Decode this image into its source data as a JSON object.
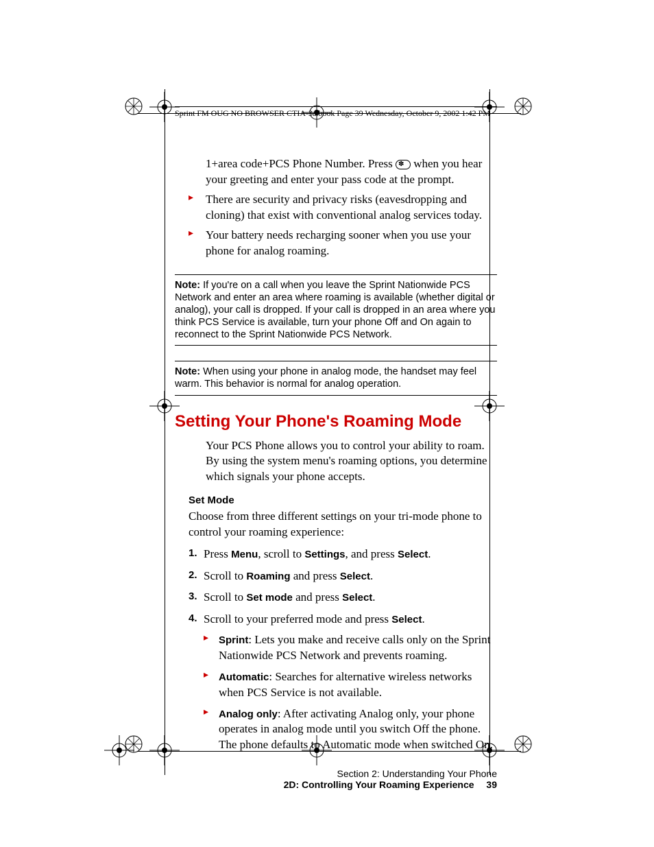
{
  "header": {
    "running_head": "Sprint FM OUG NO BROWSER CTIA-3a.book  Page 39  Wednesday, October 9, 2002  1:42 PM"
  },
  "intro": {
    "continuation_text_pre": "1+area code+PCS Phone Number. Press ",
    "continuation_text_post": " when you hear your greeting and enter your pass code at the prompt.",
    "bullets": [
      "There are security and privacy risks (eavesdropping and cloning) that exist with conventional analog services today.",
      "Your battery needs recharging sooner when you use your phone for analog roaming."
    ]
  },
  "key_icon_label": "✽",
  "notes": {
    "label": "Note:",
    "note1": " If you're on a call when you leave the Sprint Nationwide PCS Network and enter an area where roaming is available (whether digital or analog), your call is dropped. If your call is dropped in an area where you think PCS Service is available, turn your phone Off and On again to reconnect to the Sprint Nationwide PCS Network.",
    "note2": " When using your phone in analog mode, the handset may feel warm. This behavior is normal for analog operation."
  },
  "section": {
    "heading": "Setting Your Phone's Roaming Mode",
    "intro": "Your PCS Phone allows you to control your ability to roam. By using the system menu's roaming options, you determine which signals your phone accepts.",
    "sub_heading": "Set Mode",
    "sub_intro": "Choose from three different settings on your tri-mode phone to control your roaming experience:",
    "steps": {
      "s1_pre": "Press ",
      "s1_b1": "Menu",
      "s1_mid1": ", scroll to ",
      "s1_b2": "Settings",
      "s1_mid2": ", and press ",
      "s1_b3": "Select",
      "s1_post": ".",
      "s2_pre": "Scroll to ",
      "s2_b1": "Roaming",
      "s2_mid": " and press ",
      "s2_b2": "Select",
      "s2_post": ".",
      "s3_pre": "Scroll to ",
      "s3_b1": "Set mode",
      "s3_mid": " and press ",
      "s3_b2": "Select",
      "s3_post": ".",
      "s4_pre": "Scroll to your preferred mode and press ",
      "s4_b1": "Select",
      "s4_post": ".",
      "nums": [
        "1.",
        "2.",
        "3.",
        "4."
      ]
    },
    "modes": {
      "m1_bold": "Sprint",
      "m1_text": ": Lets you make and receive calls only on the Sprint Nationwide PCS Network and prevents roaming.",
      "m2_bold": "Automatic",
      "m2_text": ": Searches for alternative wireless networks when PCS Service is not available.",
      "m3_bold": "Analog only",
      "m3_text": ": After activating Analog only, your phone operates in analog mode until you switch Off the phone. The phone defaults to Automatic mode when switched On."
    }
  },
  "footer": {
    "section_line": "Section 2: Understanding Your Phone",
    "chapter_line": "2D: Controlling Your Roaming Experience",
    "page_number": "39"
  }
}
